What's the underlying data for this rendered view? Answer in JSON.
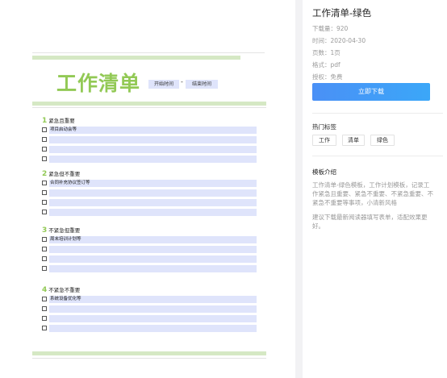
{
  "document": {
    "title": "工作清单",
    "start_label": "开始时间",
    "date_separator": "-",
    "end_label": "结束时间",
    "sections": [
      {
        "number": "1",
        "title": "紧急且重要",
        "tasks": [
          "项目启动会等",
          "",
          "",
          ""
        ]
      },
      {
        "number": "2",
        "title": "紧急但不重要",
        "tasks": [
          "合同补充协议签订等",
          "",
          "",
          ""
        ]
      },
      {
        "number": "3",
        "title": "不紧急但重要",
        "tasks": [
          "周末培训计划等",
          "",
          "",
          ""
        ]
      },
      {
        "number": "4",
        "title": "不紧急不重要",
        "tasks": [
          "系统设备优化等",
          "",
          "",
          ""
        ]
      }
    ]
  },
  "panel": {
    "title": "工作清单-绿色",
    "downloads": "下载量：920",
    "time": "时间：2020-04-30",
    "pages": "页数：1页",
    "format": "格式：pdf",
    "license": "授权：免费",
    "download_button": "立即下载",
    "hot_tags_title": "热门标签",
    "tags": [
      "工作",
      "清单",
      "绿色"
    ],
    "intro_title": "模板介绍",
    "intro_text": "工作清单-绿色模板，工作计划模板，记录工作紧急且重要、紧急不重要、不紧急重要、不紧急不重要等事项，小清新风格",
    "intro_tip": "建议下载最新阅读器填写表单，适配效果更好。"
  },
  "colors": {
    "accent_green": "#92c955",
    "bar_green": "#d5e8c4",
    "row_blue": "#dfe4fb",
    "button_blue": "#4a90f6"
  }
}
